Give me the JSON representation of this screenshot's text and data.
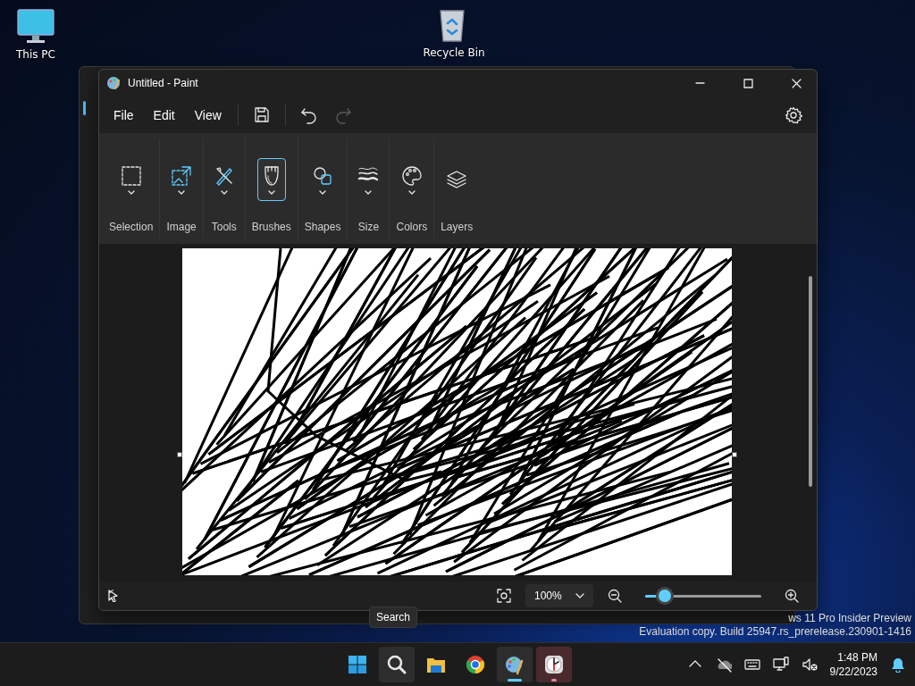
{
  "desktop_icons": [
    {
      "label": "This PC",
      "kind": "pc"
    },
    {
      "label": "Recycle Bin",
      "kind": "bin"
    }
  ],
  "paint": {
    "title": "Untitled - Paint",
    "menu": [
      "File",
      "Edit",
      "View"
    ],
    "quick_actions": [
      {
        "kind": "save",
        "disabled": false
      },
      {
        "kind": "undo",
        "disabled": false
      },
      {
        "kind": "redo",
        "disabled": true
      }
    ],
    "ribbon": [
      {
        "label": "Selection",
        "kind": "selection",
        "dropdown": true,
        "selected": false
      },
      {
        "label": "Image",
        "kind": "image",
        "dropdown": true,
        "selected": false
      },
      {
        "label": "Tools",
        "kind": "tools",
        "dropdown": true,
        "selected": false
      },
      {
        "label": "Brushes",
        "kind": "brushes",
        "dropdown": true,
        "selected": true
      },
      {
        "label": "Shapes",
        "kind": "shapes",
        "dropdown": true,
        "selected": false
      },
      {
        "label": "Size",
        "kind": "size",
        "dropdown": true,
        "selected": false
      },
      {
        "label": "Colors",
        "kind": "colors",
        "dropdown": true,
        "selected": false
      },
      {
        "label": "Layers",
        "kind": "layers",
        "dropdown": false,
        "selected": false
      }
    ],
    "zoom": {
      "value": "100%",
      "level": 0.17
    }
  },
  "tooltip": "Search",
  "watermark": [
    "ws 11 Pro Insider Preview",
    "Evaluation copy. Build 25947.rs_prerelease.230901-1416"
  ],
  "taskbar": {
    "apps": [
      {
        "kind": "start",
        "running": false,
        "active": false,
        "hovered": false,
        "flashing": false
      },
      {
        "kind": "search",
        "running": false,
        "active": false,
        "hovered": true,
        "flashing": false
      },
      {
        "kind": "explorer",
        "running": false,
        "active": false,
        "hovered": false,
        "flashing": false
      },
      {
        "kind": "chrome",
        "running": false,
        "active": false,
        "hovered": false,
        "flashing": false
      },
      {
        "kind": "paint",
        "running": true,
        "active": true,
        "hovered": false,
        "flashing": false
      },
      {
        "kind": "clock",
        "running": true,
        "active": false,
        "hovered": false,
        "flashing": true
      }
    ],
    "time": "1:48 PM",
    "date": "9/22/2023"
  }
}
